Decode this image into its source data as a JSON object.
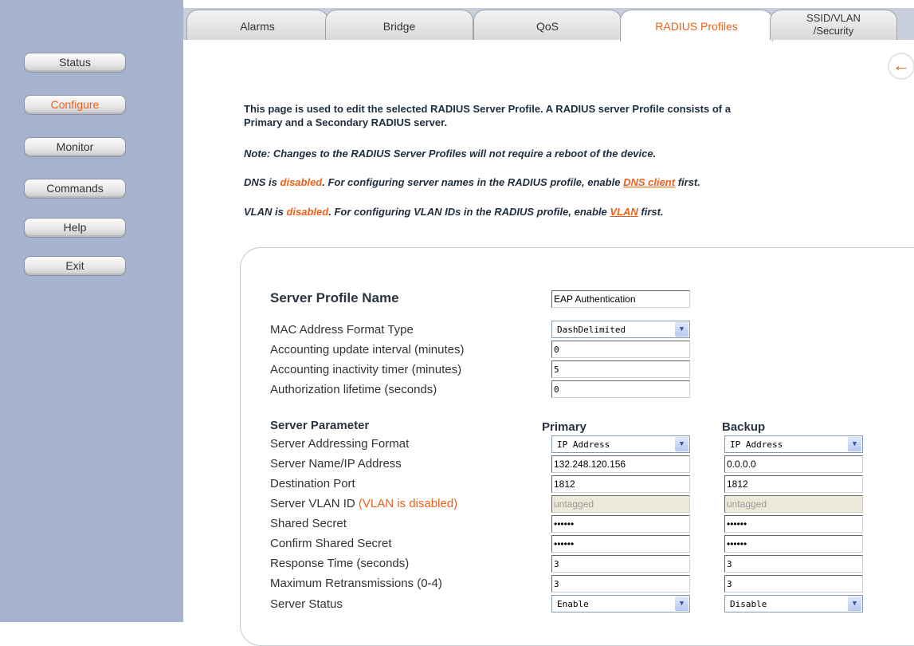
{
  "tabs": [
    {
      "label": "Alarms"
    },
    {
      "label": "Bridge"
    },
    {
      "label": "QoS"
    },
    {
      "label": "RADIUS Profiles"
    },
    {
      "label_line1": "SSID/VLAN",
      "label_line2": "/Security"
    }
  ],
  "nav": [
    {
      "label": "Status"
    },
    {
      "label": "Configure"
    },
    {
      "label": "Monitor"
    },
    {
      "label": "Commands"
    },
    {
      "label": "Help"
    },
    {
      "label": "Exit"
    }
  ],
  "back_icon": "back-arrow-icon",
  "intro": {
    "line1": "This page is used to edit the selected RADIUS Server Profile. A RADIUS server Profile consists of a",
    "line2": "Primary and a Secondary RADIUS server.",
    "note": "Note: Changes to the RADIUS Server Profiles will not require a reboot of the device.",
    "dns_prefix": "DNS is ",
    "dns_state": "disabled",
    "dns_middle": ". For configuring server names in the RADIUS profile, enable ",
    "dns_link": "DNS client",
    "dns_suffix": " first.",
    "vlan_prefix": "VLAN is ",
    "vlan_state": "disabled",
    "vlan_middle": ". For configuring VLAN IDs in the RADIUS profile, enable ",
    "vlan_link": "VLAN",
    "vlan_suffix": " first."
  },
  "form": {
    "profile_name_label": "Server Profile Name",
    "profile_name_value": "EAP Authentication",
    "mac_format_label": "MAC Address Format Type",
    "mac_format_value": "DashDelimited",
    "acct_update_label": "Accounting update interval (minutes)",
    "acct_update_value": "0",
    "acct_inactivity_label": "Accounting inactivity timer (minutes)",
    "acct_inactivity_value": "5",
    "auth_lifetime_label": "Authorization lifetime (seconds)",
    "auth_lifetime_value": "0",
    "server_param_header": "Server Parameter",
    "primary_header": "Primary",
    "backup_header": "Backup",
    "rows": {
      "addressing": {
        "label": "Server Addressing Format",
        "primary": "IP Address",
        "backup": "IP Address"
      },
      "name_ip": {
        "label": "Server Name/IP Address",
        "primary": "132.248.120.156",
        "backup": "0.0.0.0"
      },
      "port": {
        "label": "Destination Port",
        "primary": "1812",
        "backup": "1812"
      },
      "vlan": {
        "label": "Server VLAN ID",
        "label_note": "(VLAN is disabled)",
        "primary": "untagged",
        "backup": "untagged"
      },
      "secret": {
        "label": "Shared Secret",
        "primary": "••••••",
        "backup": "••••••"
      },
      "confirm_secret": {
        "label": "Confirm Shared Secret",
        "primary": "••••••",
        "backup": "••••••"
      },
      "response_time": {
        "label": "Response Time (seconds)",
        "primary": "3",
        "backup": "3"
      },
      "retransmissions": {
        "label": "Maximum Retransmissions (0-4)",
        "primary": "3",
        "backup": "3"
      },
      "status": {
        "label": "Server Status",
        "primary": "Enable",
        "backup": "Disable"
      }
    }
  },
  "colors": {
    "accent": "#f06018",
    "sidebar": "#a5b3cf",
    "text_dark": "#1e2e3e"
  }
}
